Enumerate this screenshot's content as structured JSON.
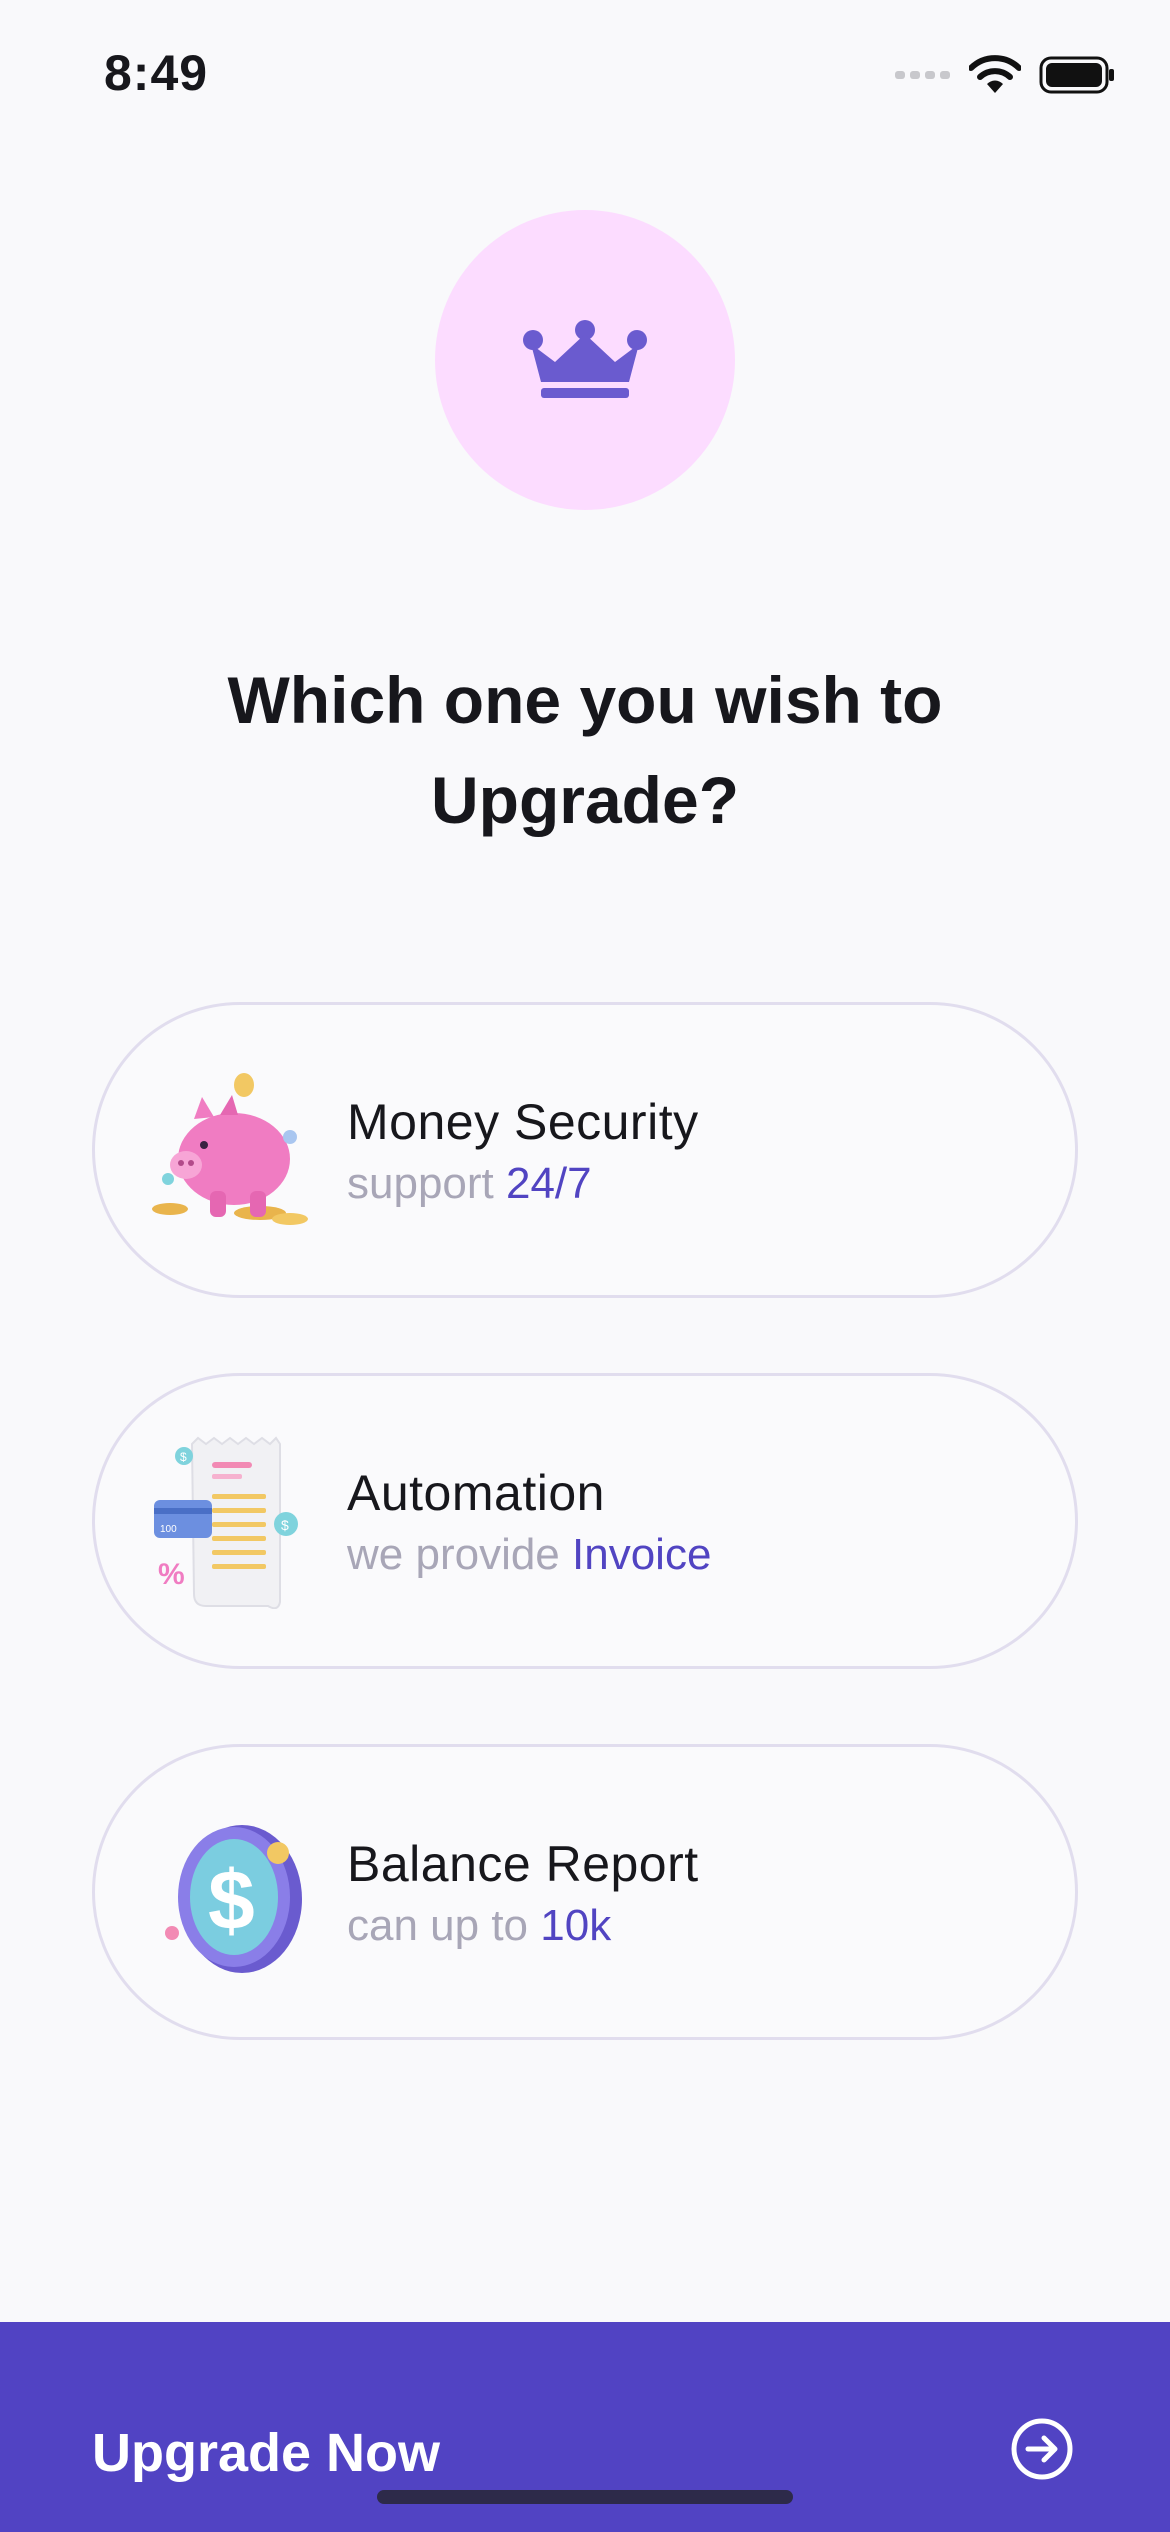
{
  "status": {
    "time": "8:49"
  },
  "headline": {
    "line1": "Which one you wish to",
    "line2": "Upgrade?"
  },
  "options": [
    {
      "title": "Money Security",
      "sub_prefix": "support ",
      "sub_accent": "24/7",
      "icon": "piggy-bank-icon"
    },
    {
      "title": "Automation",
      "sub_prefix": "we provide ",
      "sub_accent": "Invoice",
      "icon": "invoice-receipt-icon"
    },
    {
      "title": "Balance Report",
      "sub_prefix": "can up to ",
      "sub_accent": "10k",
      "icon": "dollar-coin-icon"
    }
  ],
  "receipt_card_text": "100",
  "cta": {
    "label": "Upgrade Now",
    "icon": "arrow-right-circle-icon"
  },
  "colors": {
    "accent": "#5143c3",
    "crown_bg": "#fcdcff",
    "crown": "#6a5bcf"
  }
}
